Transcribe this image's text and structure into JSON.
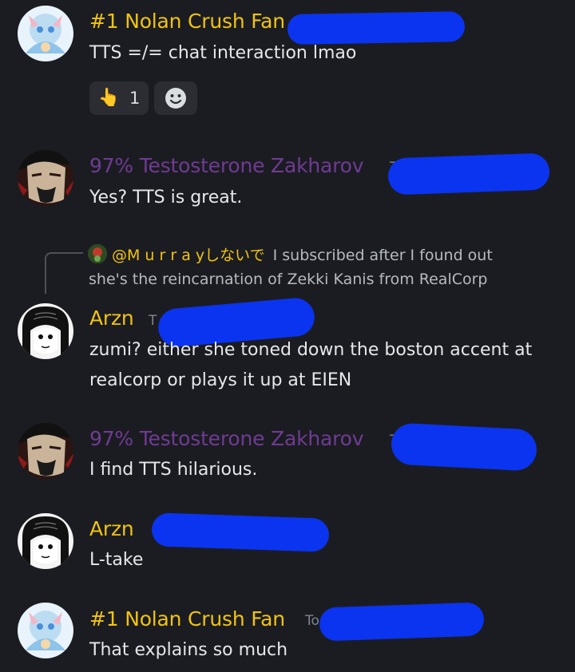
{
  "messages": [
    {
      "author": "#1 Nolan Crush Fan",
      "author_color": "#f1c40f",
      "text": "TTS =/= chat interaction lmao",
      "reactions": [
        {
          "emoji": "👆",
          "count": "1"
        },
        {
          "emoji": "☻",
          "count": ""
        }
      ]
    },
    {
      "author": "97% Testosterone Zakharov",
      "author_color": "#6f3b93",
      "timestamp_fragment": "T",
      "text": "Yes? TTS is great."
    },
    {
      "reply": {
        "author": "@M u r r a yしないで",
        "text_line1": "I subscribed after I found out",
        "text_line2": "she's the reincarnation of Zekki Kanis from RealCorp"
      },
      "author": "Arzn",
      "author_color": "#f1c40f",
      "timestamp_fragment": "T",
      "text_line1": "zumi? either she toned down the boston accent at",
      "text_line2": "realcorp or plays it up at EIEN"
    },
    {
      "author": "97% Testosterone Zakharov",
      "author_color": "#6f3b93",
      "timestamp_fragment": "T",
      "text": "I find TTS hilarious."
    },
    {
      "author": "Arzn",
      "author_color": "#f1c40f",
      "text": "L-take"
    },
    {
      "author": "#1 Nolan Crush Fan",
      "author_color": "#f1c40f",
      "timestamp_fragment": "To",
      "text": "That explains so much"
    }
  ],
  "colors": {
    "background": "#1b1c21",
    "redaction": "#0b34f0",
    "text": "#e6e7ea",
    "timestamp": "#80848e"
  }
}
